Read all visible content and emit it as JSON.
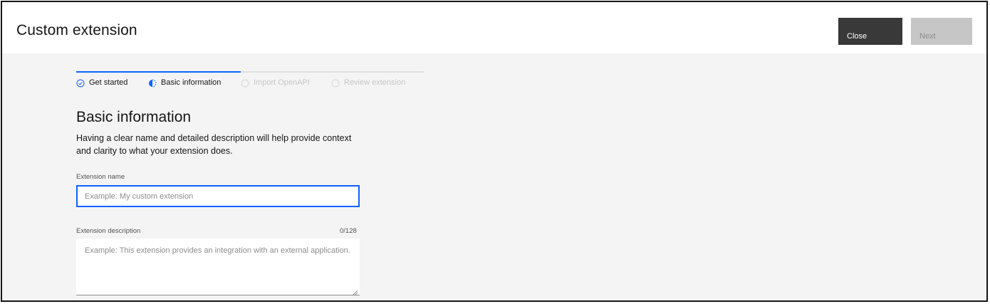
{
  "header": {
    "title": "Custom extension",
    "close_label": "Close",
    "next_label": "Next"
  },
  "progress": {
    "steps": [
      {
        "label": "Get started",
        "state": "complete",
        "icon": "checkmark-outline-icon"
      },
      {
        "label": "Basic information",
        "state": "current",
        "icon": "incomplete-half-icon"
      },
      {
        "label": "Import OpenAPI",
        "state": "incomplete",
        "icon": "circle-dash-icon"
      },
      {
        "label": "Review extension",
        "state": "incomplete",
        "icon": "circle-dash-icon"
      }
    ]
  },
  "main": {
    "title": "Basic information",
    "description": "Having a clear name and detailed description will help provide context and clarity to what your extension does.",
    "name_field": {
      "label": "Extension name",
      "placeholder": "Example: My custom extension",
      "value": ""
    },
    "description_field": {
      "label": "Extension description",
      "placeholder": "Example: This extension provides an integration with an external application.",
      "counter": "0/128",
      "value": ""
    }
  },
  "colors": {
    "accent": "#0f62fe",
    "close_button": "#393939",
    "next_button_disabled": "#c6c6c6",
    "background": "#f4f4f4"
  }
}
